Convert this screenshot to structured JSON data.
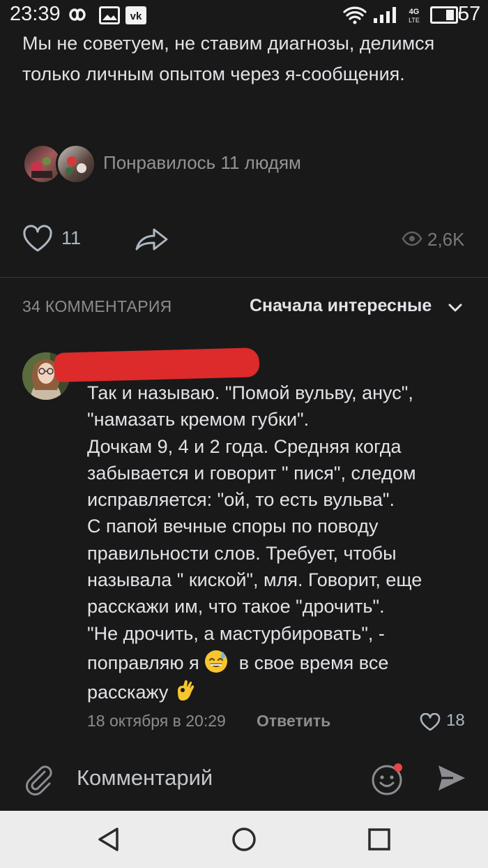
{
  "status_bar": {
    "time": "23:39",
    "battery_level": "57",
    "network": "4G"
  },
  "post": {
    "text": "Мы не советуем, не ставим диагнозы, делимся только личным опытом через я-сообщения.",
    "liked_by_text": "Понравилось 11 людям",
    "likes_count": "11",
    "views": "2,6K"
  },
  "comments_header": {
    "count_label": "34 КОММЕНТАРИЯ",
    "sort_label": "Сначала интересные"
  },
  "comment": {
    "body_lines": [
      "Так и называю. \"Помой вульву, анус\",",
      "\"намазать кремом губки\".",
      "Дочкам 9, 4 и 2 года. Средняя когда",
      "забывается и говорит \" пися\", следом",
      "исправляется: \"ой, то есть вульва\".",
      "С папой вечные споры по поводу",
      "правильности слов. Требует, чтобы",
      "называла \" киской\", мля. Говорит, еще",
      "расскажи им, что такое \"дрочить\".",
      "\"Не дрочить, а мастурбировать\", -",
      "поправляю я",
      "в свое время все",
      "расскажу"
    ],
    "date": "18 октября в 20:29",
    "reply_label": "Ответить",
    "likes": "18"
  },
  "composer": {
    "placeholder": "Комментарий"
  },
  "icons": {
    "heart": "heart-icon",
    "share": "share-icon",
    "eye": "eye-icon",
    "chevron": "chevron-down-icon",
    "attach": "paperclip-icon",
    "emoji": "emoji-icon",
    "send": "send-icon"
  },
  "colors": {
    "background": "#19191a",
    "accent_notification": "#e64646",
    "text_secondary": "#8b8d90"
  }
}
